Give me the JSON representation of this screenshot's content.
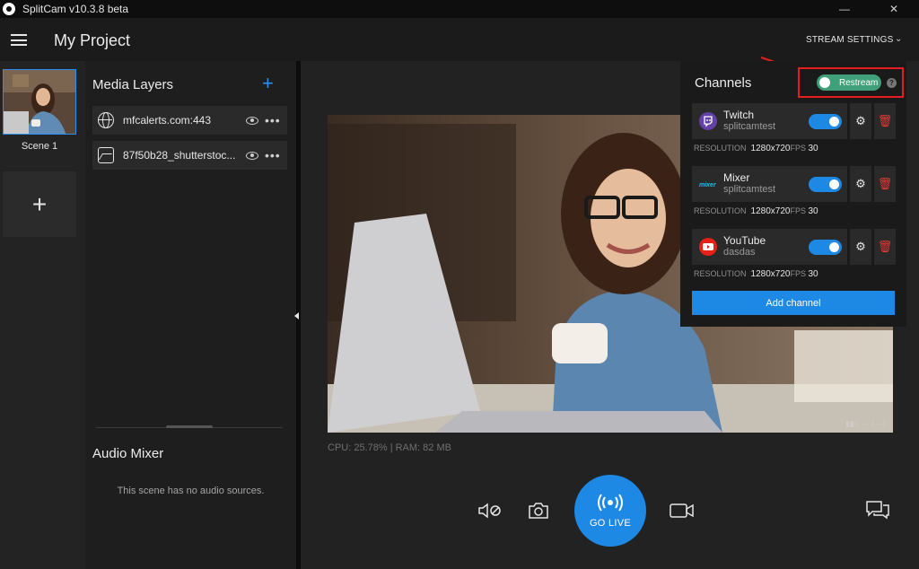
{
  "titlebar": {
    "title": "SplitCam v10.3.8 beta",
    "minimize": "—",
    "close": "✕"
  },
  "header": {
    "project_title": "My Project",
    "stream_settings": "STREAM SETTINGS",
    "chevron": "⌄"
  },
  "scenes": {
    "items": [
      {
        "label": "Scene 1"
      }
    ],
    "add_label": "+"
  },
  "media_layers": {
    "title": "Media Layers",
    "add_label": "+",
    "items": [
      {
        "name": "mfcalerts.com:443",
        "icon": "globe-icon"
      },
      {
        "name": "87f50b28_shutterstoc...",
        "icon": "image-icon"
      }
    ]
  },
  "audio_mixer": {
    "title": "Audio Mixer",
    "empty_text": "This scene has no audio sources."
  },
  "status": {
    "cpu_ram": "CPU: 25.78% | RAM: 82 MB"
  },
  "controls": {
    "go_live_label": "GO LIVE"
  },
  "channels": {
    "title": "Channels",
    "restream_label": "Restream",
    "restream_on": true,
    "help": "?",
    "resolution_label": "RESOLUTION",
    "fps_label": "FPS",
    "items": [
      {
        "name": "Twitch",
        "username": "splitcamtest",
        "resolution": "1280x720",
        "fps": "30",
        "color": "#6441a5",
        "enabled": true
      },
      {
        "name": "Mixer",
        "username": "splitcamtest",
        "resolution": "1280x720",
        "fps": "30",
        "color": "#1fbaed",
        "enabled": true
      },
      {
        "name": "YouTube",
        "username": "dasdas",
        "resolution": "1280x720",
        "fps": "30",
        "color": "#e62117",
        "enabled": true
      }
    ],
    "add_channel_label": "Add channel"
  },
  "colors": {
    "accent": "#1e88e5",
    "highlight": "#e41e1e",
    "restream": "#3fa07a",
    "selected_scene": "#2d8cf0"
  }
}
